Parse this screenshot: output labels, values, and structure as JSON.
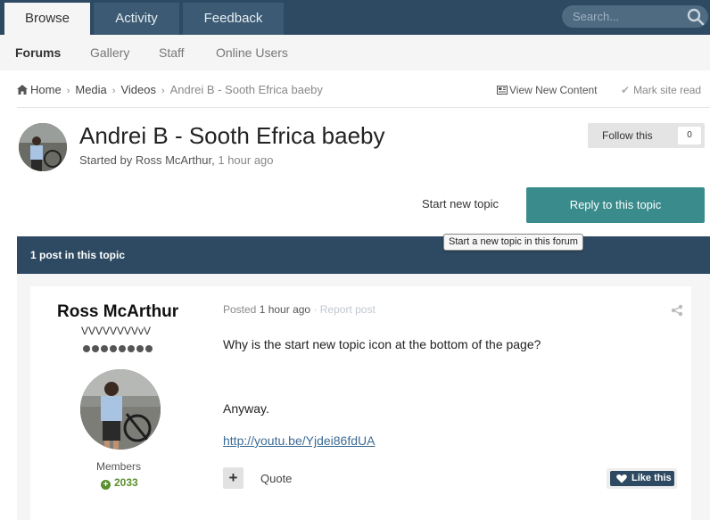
{
  "top_nav": {
    "tabs": [
      {
        "label": "Browse",
        "active": true
      },
      {
        "label": "Activity",
        "active": false
      },
      {
        "label": "Feedback",
        "active": false
      }
    ],
    "search_placeholder": "Search...",
    "search_icon": "search-icon"
  },
  "sub_nav": {
    "items": [
      {
        "label": "Forums",
        "active": true
      },
      {
        "label": "Gallery",
        "active": false
      },
      {
        "label": "Staff",
        "active": false
      },
      {
        "label": "Online Users",
        "active": false
      }
    ]
  },
  "breadcrumb": {
    "items": [
      "Home",
      "Media",
      "Videos",
      "Andrei B - Sooth Efrica baeby"
    ],
    "view_new_content": "View New Content",
    "mark_site_read": "Mark site read"
  },
  "topic": {
    "title": "Andrei B - Sooth Efrica baeby",
    "started_by": "Started by Ross McArthur,",
    "started_time": "1 hour ago",
    "follow_label": "Follow this",
    "follow_count": "0",
    "start_new_topic": "Start new topic",
    "reply_label": "Reply to this topic",
    "tooltip": "Start a new topic in this forum",
    "posts_count_label": "1 post in this topic"
  },
  "post": {
    "author": "Ross McArthur",
    "rank_title": "VVVVVVVVvV",
    "rank_pips": 8,
    "group": "Members",
    "reputation": "2033",
    "posted_label": "Posted",
    "posted_time": "1 hour ago",
    "report_label": "· Report post",
    "body": [
      "Why is the start new topic icon at the bottom of the page?",
      "Anyway."
    ],
    "link": "http://youtu.be/Yjdei86fdUA",
    "plus_label": "+",
    "quote_label": "Quote",
    "like_label": "Like this"
  },
  "colors": {
    "nav_bg": "#2e4a62",
    "accent_teal": "#3a8b8c",
    "rep_green": "#5a8f2e"
  }
}
